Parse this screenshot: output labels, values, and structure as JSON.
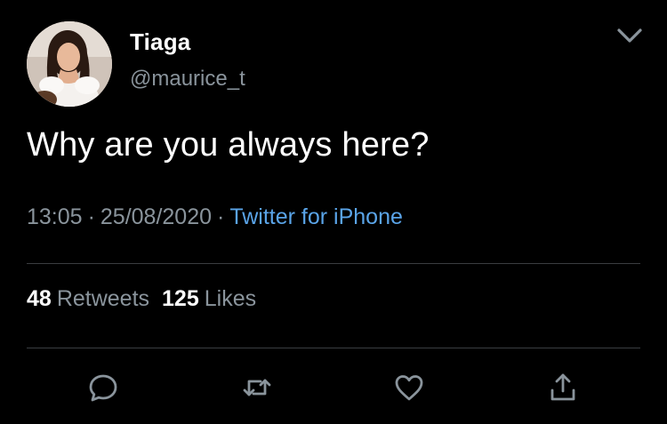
{
  "user": {
    "display_name": "Tiaga",
    "handle": "@maurice_t"
  },
  "tweet": {
    "text": "Why are you always here?",
    "time": "13:05",
    "separator": "·",
    "date": "25/08/2020",
    "source": "Twitter for iPhone"
  },
  "stats": {
    "retweets_count": "48",
    "retweets_label": "Retweets",
    "likes_count": "125",
    "likes_label": "Likes"
  },
  "icons": {
    "menu": "chevron-down-icon",
    "reply": "reply-icon",
    "retweet": "retweet-icon",
    "like": "heart-icon",
    "share": "share-icon"
  },
  "colors": {
    "background": "#000000",
    "text_primary": "#ffffff",
    "text_secondary": "#8a949c",
    "link": "#5aa4e8",
    "divider": "#3a3d40"
  }
}
